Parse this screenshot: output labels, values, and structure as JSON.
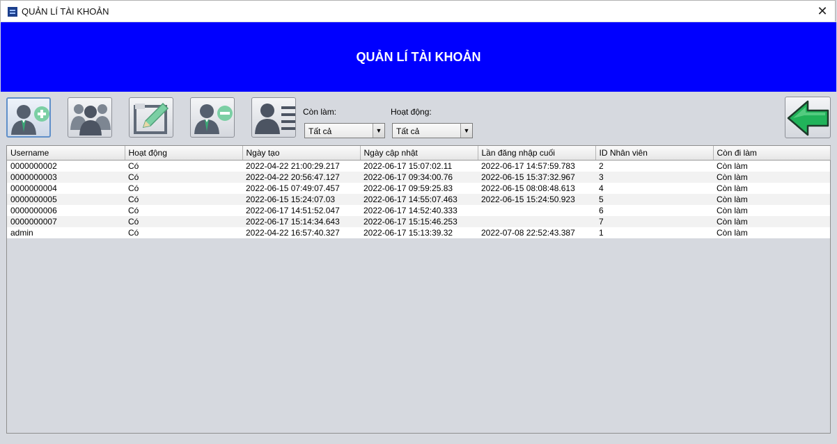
{
  "window": {
    "title": "QUẢN LÍ TÀI KHOẢN",
    "close_glyph": "✕"
  },
  "header": {
    "title": "QUẢN LÍ TÀI KHOẢN",
    "background": "#0000ff"
  },
  "toolbar": {
    "buttons": [
      {
        "name": "add-user",
        "icon": "add-user-icon"
      },
      {
        "name": "users-group",
        "icon": "users-group-icon"
      },
      {
        "name": "edit",
        "icon": "edit-icon"
      },
      {
        "name": "remove-user",
        "icon": "remove-user-icon"
      },
      {
        "name": "user-details",
        "icon": "user-details-icon"
      }
    ],
    "back_icon": "back-arrow-icon"
  },
  "filters": {
    "con_lam": {
      "label": "Còn làm:",
      "value": "Tất cả"
    },
    "hoat_dong": {
      "label": "Hoạt động:",
      "value": "Tất cả"
    }
  },
  "table": {
    "columns": [
      "Username",
      "Hoạt động",
      "Ngày tạo",
      "Ngày cập nhật",
      "Lần đăng nhập cuối",
      "ID Nhân viên",
      "Còn đi làm"
    ],
    "rows": [
      [
        "0000000002",
        "Có",
        "2022-04-22 21:00:29.217",
        "2022-06-17 15:07:02.11",
        "2022-06-17 14:57:59.783",
        "2",
        "Còn làm"
      ],
      [
        "0000000003",
        "Có",
        "2022-04-22 20:56:47.127",
        "2022-06-17 09:34:00.76",
        "2022-06-15 15:37:32.967",
        "3",
        "Còn làm"
      ],
      [
        "0000000004",
        "Có",
        "2022-06-15 07:49:07.457",
        "2022-06-17 09:59:25.83",
        "2022-06-15 08:08:48.613",
        "4",
        "Còn làm"
      ],
      [
        "0000000005",
        "Có",
        "2022-06-15 15:24:07.03",
        "2022-06-17 14:55:07.463",
        "2022-06-15 15:24:50.923",
        "5",
        "Còn làm"
      ],
      [
        "0000000006",
        "Có",
        "2022-06-17 14:51:52.047",
        "2022-06-17 14:52:40.333",
        "",
        "6",
        "Còn làm"
      ],
      [
        "0000000007",
        "Có",
        "2022-06-17 15:14:34.643",
        "2022-06-17 15:15:46.253",
        "",
        "7",
        "Còn làm"
      ],
      [
        "admin",
        "Có",
        "2022-04-22 16:57:40.327",
        "2022-06-17 15:13:39.32",
        "2022-07-08 22:52:43.387",
        "1",
        "Còn làm"
      ]
    ]
  }
}
